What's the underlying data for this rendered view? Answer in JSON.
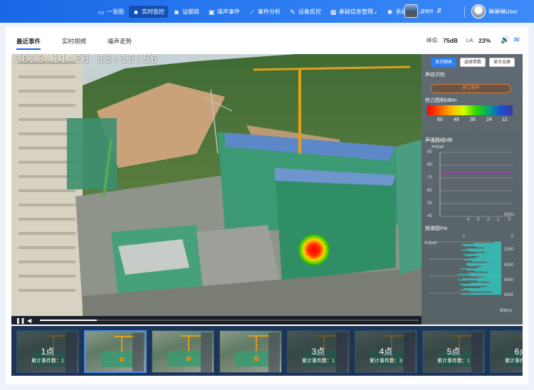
{
  "nav": {
    "items": [
      {
        "label": "一张图",
        "icon": "monitor-icon",
        "active": false
      },
      {
        "label": "实时监控",
        "icon": "video-camera-icon",
        "active": true
      },
      {
        "label": "证据链",
        "icon": "camera-icon",
        "active": false
      },
      {
        "label": "噪声事件",
        "icon": "alert-icon",
        "active": false
      },
      {
        "label": "事件分析",
        "icon": "line-chart-icon",
        "active": false
      },
      {
        "label": "设备反控",
        "icon": "wrench-icon",
        "active": false
      },
      {
        "label": "基础信息管理",
        "icon": "grid-icon",
        "active": false,
        "dropdown": true
      },
      {
        "label": "系统管理",
        "icon": "gear-icon",
        "active": false,
        "dropdown": true
      }
    ],
    "user1": {
      "name": "管理员"
    },
    "user2": {
      "name": "琳琳琳User"
    }
  },
  "tabs": [
    "最近事件",
    "实时视频",
    "噪声走势"
  ],
  "metrics": {
    "peak_label": "峰值:",
    "peak_value": "75dB",
    "la_label": "LA:",
    "la_value": "23%"
  },
  "video": {
    "timestamp": "2023-11-23 15:15:56",
    "progress": 0.15
  },
  "panel": {
    "buttons": [
      "显示图表",
      "选择参数",
      "显示全屏"
    ],
    "sound_title": "声纹识别",
    "sound_value": "施工噪声",
    "heat_title": "热力图例/dBm",
    "heat_labels": [
      "60",
      "48",
      "36",
      "24",
      "12"
    ],
    "curve_title": "声强曲线/dB",
    "curve_yaxis": [
      "90",
      "80",
      "70",
      "60",
      "50",
      "40"
    ],
    "curve_xaxis": [
      "4",
      "3",
      "2",
      "1",
      "0"
    ],
    "curve_xunit": "时间/s",
    "curve_yunit": "声强/dB",
    "spectrum_title": "频谱图/Hz",
    "spectrum_top": [
      "1",
      "0"
    ],
    "spectrum_yaxis": [
      "2000",
      "4000",
      "6000",
      "8000"
    ],
    "spectrum_yunit": "声强/dB",
    "spectrum_xunit": "频率/Hz"
  },
  "thumbs": [
    {
      "label": "1点",
      "count": "累计事件数：1",
      "shaded": true
    },
    {
      "label": "",
      "count": "",
      "shaded": false,
      "selected": true
    },
    {
      "label": "",
      "count": "",
      "shaded": false
    },
    {
      "label": "",
      "count": "",
      "shaded": false
    },
    {
      "label": "3点",
      "count": "累计事件数：1",
      "shaded": true
    },
    {
      "label": "4点",
      "count": "累计事件数：3",
      "shaded": true
    },
    {
      "label": "5点",
      "count": "累计事件数：1",
      "shaded": true
    },
    {
      "label": "6点",
      "count": "累计事件数：1",
      "shaded": true
    }
  ],
  "colors": {
    "brand": "#1a68e6",
    "accent": "#f18b36"
  }
}
